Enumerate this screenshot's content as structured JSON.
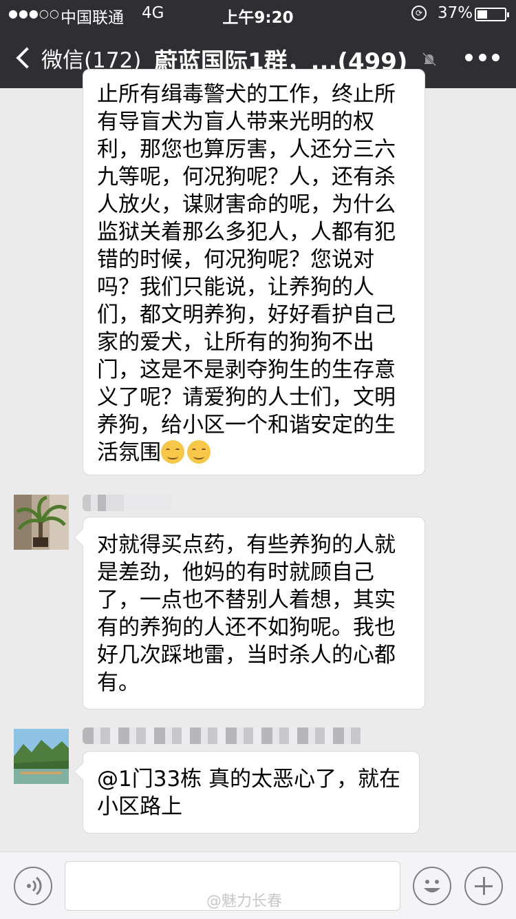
{
  "status": {
    "signal": "●●●○○",
    "carrier": "中国联通",
    "network": "4G",
    "time": "上午9:20",
    "battery": "37%",
    "battery_level": 0.37
  },
  "nav": {
    "back_label": "微信(172)",
    "title": "蔚蓝国际1群，...(499)"
  },
  "messages": [
    {
      "lines": [
        "止所有缉毒警犬的工作，终止所",
        "有导盲犬为盲人带来光明的权",
        "利，那您也算厉害，人还分三六",
        "九等呢，何况狗呢？人，还有杀",
        "人放火，谋财害命的呢，为什么",
        "监狱关着那么多犯人，人都有犯",
        "错的时候，何况狗呢？您说对",
        "吗？我们只能说，让养狗的人",
        "们，都文明养狗，好好看护自己",
        "家的爱犬，让所有的狗狗不出",
        "门，这是不是剥夺狗生的生存意",
        "义了呢？请爱狗的人士们，文明",
        "养狗，给小区一个和谐安定的生",
        "活氛围"
      ],
      "emoji": "smiling-blush"
    },
    {
      "lines": [
        "对就得买点药，有些养狗的人就",
        "是差劲，他妈的有时就顾自己",
        "了，一点也不替别人着想，其实",
        "有的养狗的人还不如狗呢。我也",
        "好几次踩地雷，当时杀人的心都",
        "有。"
      ]
    },
    {
      "lines": [
        "@1门33栋 真的太恶心了，就在",
        "小区路上"
      ]
    }
  ],
  "watermark": "@魅力长春"
}
